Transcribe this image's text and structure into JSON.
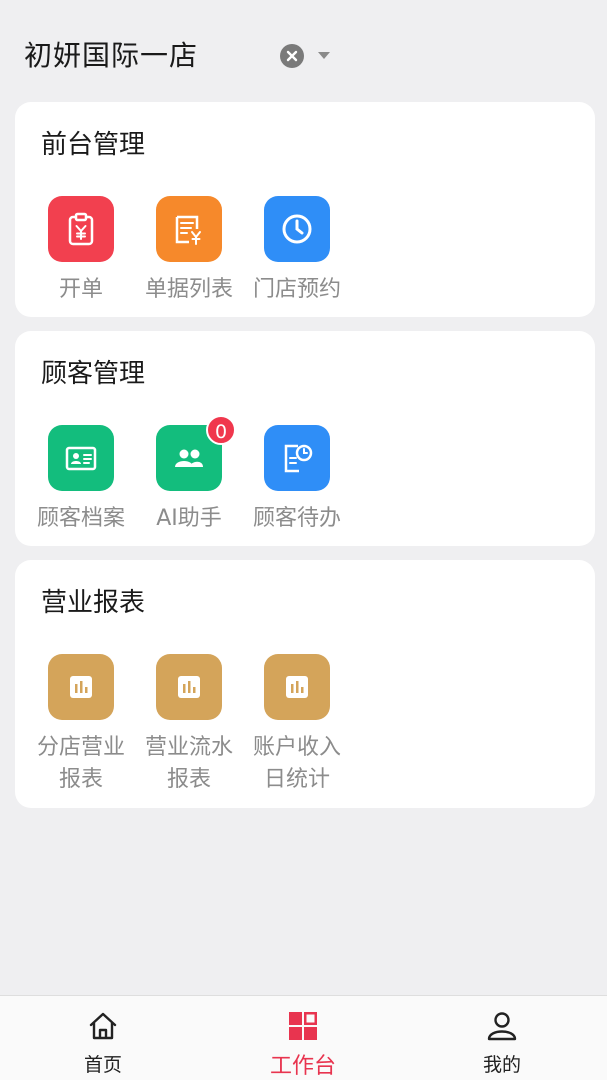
{
  "header": {
    "store_name": "初妍国际一店",
    "clear_icon": "close-circle-icon",
    "dropdown_icon": "chevron-down-icon"
  },
  "sections": [
    {
      "title": "前台管理",
      "items": [
        {
          "label": "开单",
          "icon": "clipboard-yen-icon",
          "color": "#f2404f"
        },
        {
          "label": "单据列表",
          "icon": "receipt-yen-icon",
          "color": "#f6892b"
        },
        {
          "label": "门店预约",
          "icon": "clock-icon",
          "color": "#2f8ef7"
        }
      ]
    },
    {
      "title": "顾客管理",
      "items": [
        {
          "label": "顾客档案",
          "icon": "id-card-icon",
          "color": "#13bd7d"
        },
        {
          "label": "AI助手",
          "icon": "users-icon",
          "color": "#13bd7d",
          "badge": "0"
        },
        {
          "label": "顾客待办",
          "icon": "document-clock-icon",
          "color": "#2f8ef7"
        }
      ]
    },
    {
      "title": "营业报表",
      "items": [
        {
          "label_line1": "分店营业",
          "label_line2": "报表",
          "icon": "bar-chart-icon",
          "color": "#d4a45a"
        },
        {
          "label_line1": "营业流水",
          "label_line2": "报表",
          "icon": "bar-chart-icon",
          "color": "#d4a45a"
        },
        {
          "label_line1": "账户收入",
          "label_line2": "日统计",
          "icon": "bar-chart-icon",
          "color": "#d4a45a"
        }
      ]
    }
  ],
  "tabbar": {
    "tabs": [
      {
        "label": "首页",
        "icon": "home-icon"
      },
      {
        "label": "工作台",
        "icon": "grid-icon",
        "active": true
      },
      {
        "label": "我的",
        "icon": "user-icon"
      }
    ],
    "active_color": "#e8344f"
  }
}
